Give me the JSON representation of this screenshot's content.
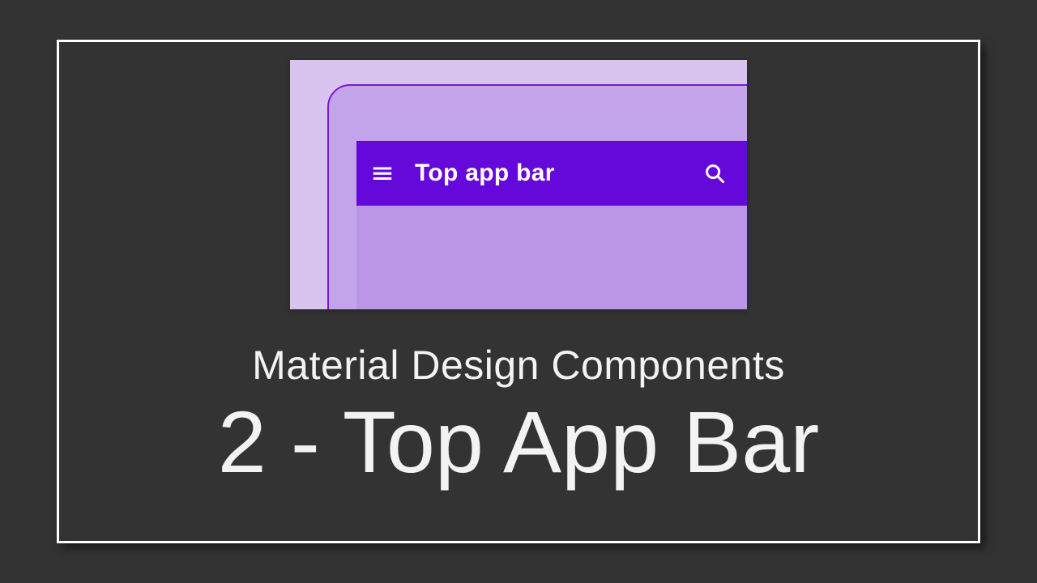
{
  "preview": {
    "app_bar_title": "Top app bar",
    "colors": {
      "background_light": "#d9c4f0",
      "device_fill": "#c3a3ea",
      "device_border": "#7a18d6",
      "app_bar": "#6509da",
      "content": "#bb96e8"
    }
  },
  "headings": {
    "subtitle": "Material Design Components",
    "title": "2 - Top App Bar"
  }
}
